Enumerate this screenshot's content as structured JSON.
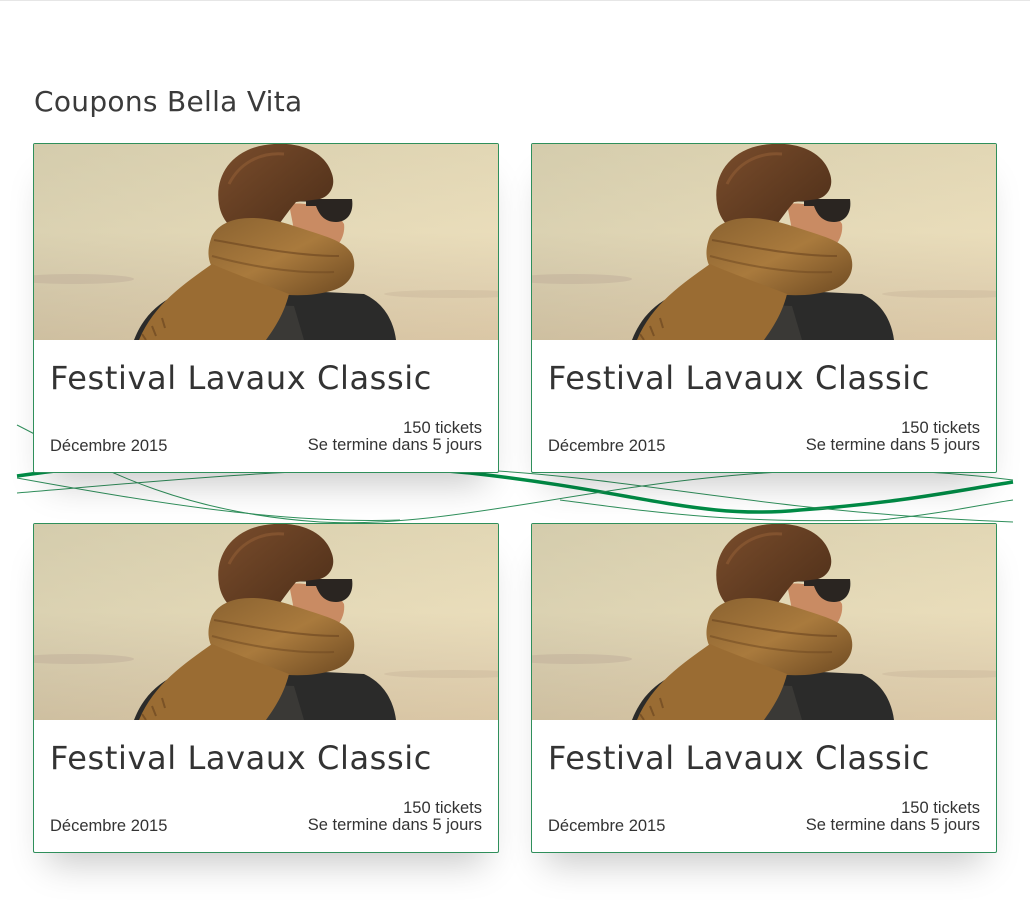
{
  "page": {
    "title": "Coupons Bella Vita"
  },
  "theme": {
    "accent": "#008c46",
    "border": "#2f8f5b",
    "text": "#333333"
  },
  "coupons": [
    {
      "title": "Festival Lavaux Classic",
      "date": "Décembre 2015",
      "tickets": "150 tickets",
      "ends": "Se termine dans 5 jours",
      "image": "man-with-scarf-and-sunglasses-photo"
    },
    {
      "title": "Festival Lavaux Classic",
      "date": "Décembre 2015",
      "tickets": "150 tickets",
      "ends": "Se termine dans 5 jours",
      "image": "man-with-scarf-and-sunglasses-photo"
    },
    {
      "title": "Festival Lavaux Classic",
      "date": "Décembre 2015",
      "tickets": "150 tickets",
      "ends": "Se termine dans 5 jours",
      "image": "man-with-scarf-and-sunglasses-photo"
    },
    {
      "title": "Festival Lavaux Classic",
      "date": "Décembre 2015",
      "tickets": "150 tickets",
      "ends": "Se termine dans 5 jours",
      "image": "man-with-scarf-and-sunglasses-photo"
    }
  ]
}
